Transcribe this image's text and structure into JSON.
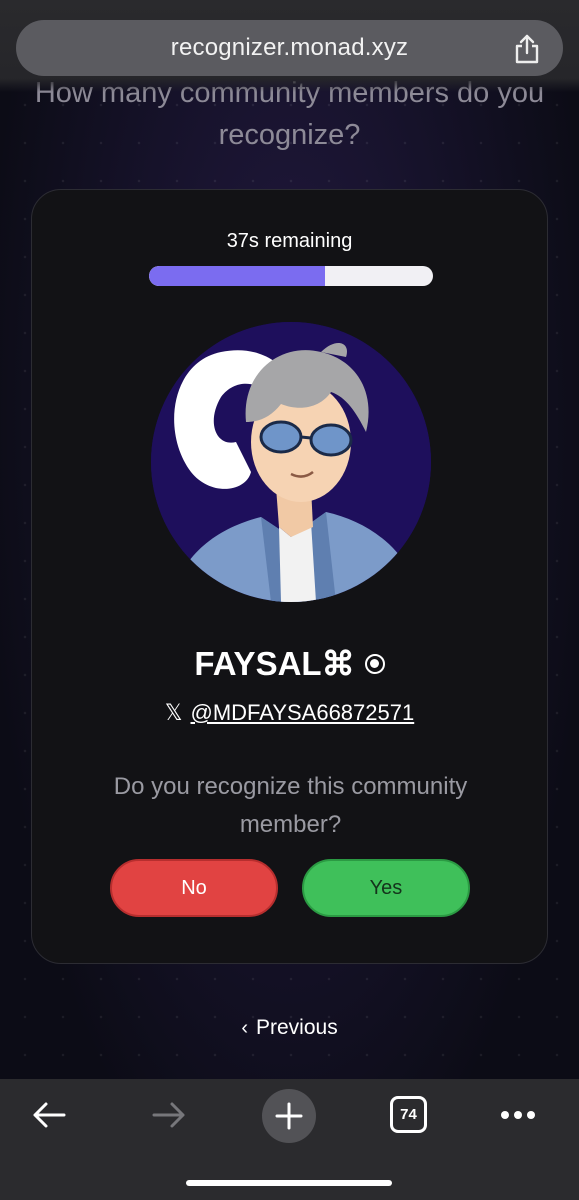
{
  "browser": {
    "url": "recognizer.monad.xyz",
    "tab_count": "74"
  },
  "page": {
    "heading": "How many community members do you recognize?"
  },
  "card": {
    "timer_text": "37s remaining",
    "progress_fraction": 0.62,
    "member": {
      "name": "FAYSAL⌘",
      "handle": "@MDFAYSA66872571",
      "platform_icon": "x-logo-icon"
    },
    "question": "Do you recognize this community member?",
    "no_label": "No",
    "yes_label": "Yes"
  },
  "nav": {
    "previous_label": "Previous"
  },
  "colors": {
    "accent": "#7b6cf0",
    "no": "#e14342",
    "yes": "#3fc05a"
  }
}
